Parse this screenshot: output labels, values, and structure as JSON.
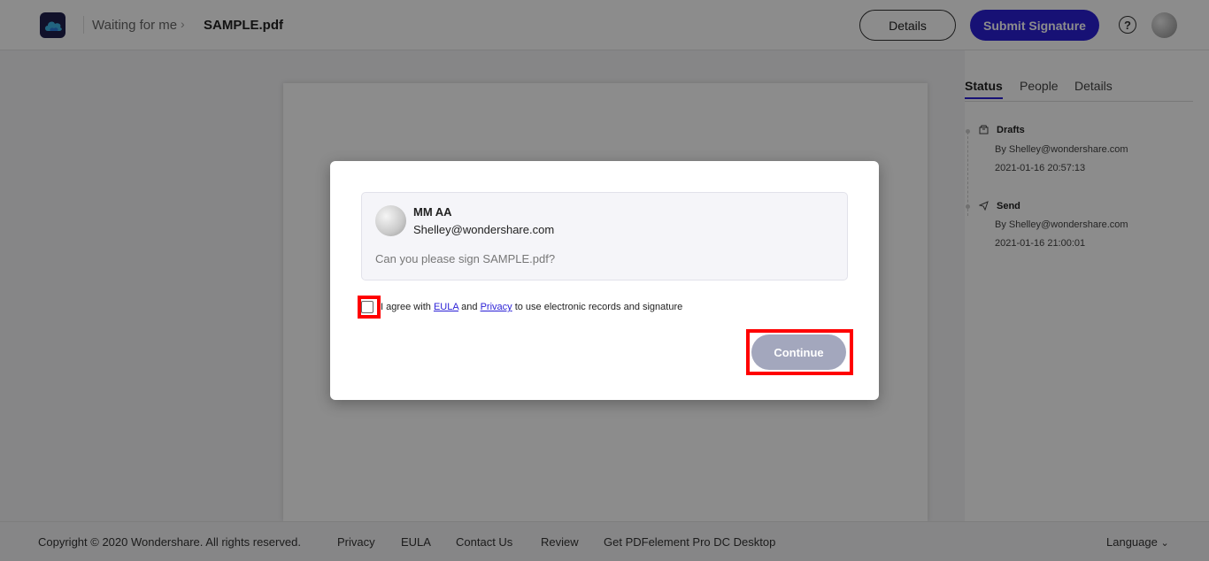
{
  "header": {
    "breadcrumb_parent": "Waiting for me",
    "breadcrumb_current": "SAMPLE.pdf",
    "details_label": "Details",
    "submit_label": "Submit Signature",
    "help_icon_glyph": "?"
  },
  "right_panel": {
    "tabs": [
      "Status",
      "People",
      "Details"
    ],
    "events": [
      {
        "icon": "drafts-icon",
        "title": "Drafts",
        "by": "By Shelley@wondershare.com",
        "time": "2021-01-16 20:57:13"
      },
      {
        "icon": "send-icon",
        "title": "Send",
        "by": "By Shelley@wondershare.com",
        "time": "2021-01-16 21:00:01"
      }
    ]
  },
  "modal": {
    "sender_name": "MM AA",
    "sender_email": "Shelley@wondershare.com",
    "message": "Can you please sign SAMPLE.pdf?",
    "agree_prefix": "I agree with",
    "eula_link": "EULA",
    "and_text": "and",
    "privacy_link": "Privacy",
    "agree_suffix": "to use electronic records and signature",
    "continue_label": "Continue",
    "checkbox_checked": false
  },
  "footer": {
    "copyright": "Copyright © 2020 Wondershare. All rights reserved.",
    "links": [
      "Privacy",
      "EULA",
      "Contact Us",
      "Review",
      "Get PDFelement Pro DC Desktop"
    ],
    "language": "Language",
    "language_chevron": "⌄"
  },
  "colors": {
    "accent": "#2a1fd6",
    "continue_disabled": "#a3a7bd",
    "highlight": "#ff0000"
  }
}
